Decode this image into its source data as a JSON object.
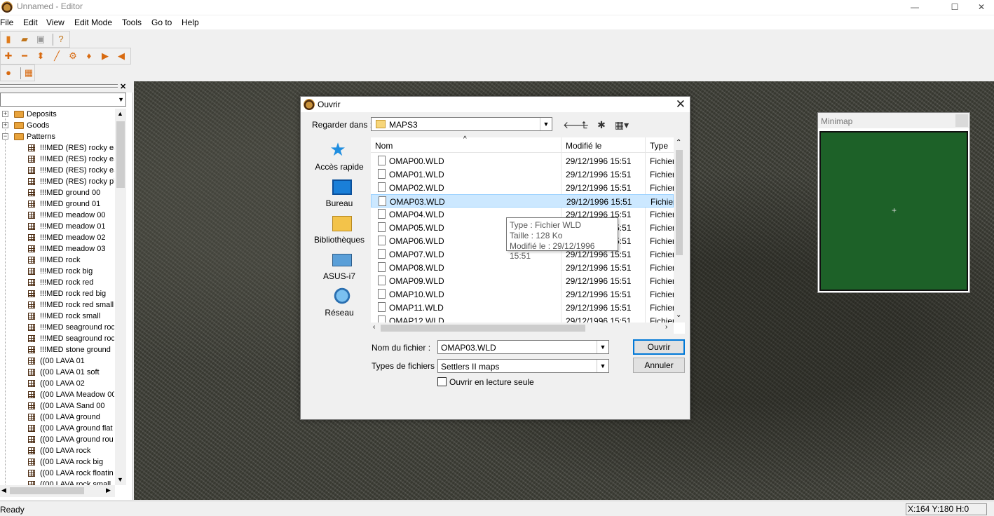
{
  "window": {
    "title": "Unnamed - Editor",
    "min": "—",
    "max": "☐",
    "close": "✕"
  },
  "menu": [
    "File",
    "Edit",
    "View",
    "Edit Mode",
    "Tools",
    "Go to",
    "Help"
  ],
  "toolbar1": [
    {
      "name": "new-icon",
      "glyph": "▮",
      "color": "#e07b1a"
    },
    {
      "name": "open-icon",
      "glyph": "▰",
      "color": "#c0741a"
    },
    {
      "name": "save-icon",
      "glyph": "▣",
      "color": "#9a9a9a"
    },
    {
      "name": "help-icon",
      "glyph": "?",
      "color": "#c0741a"
    }
  ],
  "toolbar2": [
    {
      "name": "raise-icon",
      "glyph": "✚",
      "color": "#d86a10"
    },
    {
      "name": "lower-icon",
      "glyph": "━",
      "color": "#d86a10"
    },
    {
      "name": "plane-icon",
      "glyph": "⬍",
      "color": "#d86a10"
    },
    {
      "name": "brush-icon",
      "glyph": "╱",
      "color": "#d86a10"
    },
    {
      "name": "objects-icon",
      "glyph": "⚙",
      "color": "#d86a10"
    },
    {
      "name": "fill-icon",
      "glyph": "♦",
      "color": "#d86a10"
    },
    {
      "name": "play-icon",
      "glyph": "▶",
      "color": "#d86a10"
    },
    {
      "name": "sound-icon",
      "glyph": "◀",
      "color": "#d86a10"
    }
  ],
  "toolbar3": [
    {
      "name": "marker-icon",
      "glyph": "●",
      "color": "#d86a10"
    },
    {
      "name": "copy-icon",
      "glyph": "▦",
      "color": "#d86a10"
    }
  ],
  "left_panel": {
    "close": "✕",
    "tree": [
      {
        "kind": "folder",
        "label": "Deposits",
        "expander": "+"
      },
      {
        "kind": "folder",
        "label": "Goods",
        "expander": "+"
      },
      {
        "kind": "folder",
        "label": "Patterns",
        "expander": "−"
      },
      {
        "kind": "item",
        "label": "!!!MED (RES) rocky ea"
      },
      {
        "kind": "item",
        "label": "!!!MED (RES) rocky ea"
      },
      {
        "kind": "item",
        "label": "!!!MED (RES) rocky ea"
      },
      {
        "kind": "item",
        "label": "!!!MED (RES) rocky pla"
      },
      {
        "kind": "item",
        "label": "!!!MED ground 00"
      },
      {
        "kind": "item",
        "label": "!!!MED ground 01"
      },
      {
        "kind": "item",
        "label": "!!!MED meadow 00"
      },
      {
        "kind": "item",
        "label": "!!!MED meadow 01"
      },
      {
        "kind": "item",
        "label": "!!!MED meadow 02"
      },
      {
        "kind": "item",
        "label": "!!!MED meadow 03"
      },
      {
        "kind": "item",
        "label": "!!!MED rock"
      },
      {
        "kind": "item",
        "label": "!!!MED rock big"
      },
      {
        "kind": "item",
        "label": "!!!MED rock red"
      },
      {
        "kind": "item",
        "label": "!!!MED rock red big"
      },
      {
        "kind": "item",
        "label": "!!!MED rock red small"
      },
      {
        "kind": "item",
        "label": "!!!MED rock small"
      },
      {
        "kind": "item",
        "label": "!!!MED seaground roc"
      },
      {
        "kind": "item",
        "label": "!!!MED seaground roc"
      },
      {
        "kind": "item",
        "label": "!!!MED stone ground"
      },
      {
        "kind": "item",
        "label": "((00 LAVA 01"
      },
      {
        "kind": "item",
        "label": "((00 LAVA 01 soft"
      },
      {
        "kind": "item",
        "label": "((00 LAVA 02"
      },
      {
        "kind": "item",
        "label": "((00 LAVA Meadow 00"
      },
      {
        "kind": "item",
        "label": "((00 LAVA Sand 00"
      },
      {
        "kind": "item",
        "label": "((00 LAVA ground"
      },
      {
        "kind": "item",
        "label": "((00 LAVA ground flat"
      },
      {
        "kind": "item",
        "label": "((00 LAVA ground rou"
      },
      {
        "kind": "item",
        "label": "((00 LAVA rock"
      },
      {
        "kind": "item",
        "label": "((00 LAVA rock big"
      },
      {
        "kind": "item",
        "label": "((00 LAVA rock floatin"
      },
      {
        "kind": "item",
        "label": "((00 LAVA rock small"
      }
    ]
  },
  "minimap": {
    "title": "Minimap",
    "cross": "+"
  },
  "dialog": {
    "title": "Ouvrir",
    "close": "✕",
    "look_in_label": "Regarder dans :",
    "look_in_value": "MAPS3",
    "places": [
      {
        "name": "quick-access",
        "label": "Accès rapide"
      },
      {
        "name": "desktop",
        "label": "Bureau"
      },
      {
        "name": "libraries",
        "label": "Bibliothèques"
      },
      {
        "name": "this-pc",
        "label": "ASUS-i7"
      },
      {
        "name": "network",
        "label": "Réseau"
      }
    ],
    "columns": {
      "name": "Nom",
      "modified": "Modifié le",
      "type": "Type",
      "sort_glyph": "^"
    },
    "files": [
      {
        "name": "OMAP00.WLD",
        "date": "29/12/1996 15:51",
        "type": "Fichier"
      },
      {
        "name": "OMAP01.WLD",
        "date": "29/12/1996 15:51",
        "type": "Fichier"
      },
      {
        "name": "OMAP02.WLD",
        "date": "29/12/1996 15:51",
        "type": "Fichier"
      },
      {
        "name": "OMAP03.WLD",
        "date": "29/12/1996 15:51",
        "type": "Fichier",
        "selected": true
      },
      {
        "name": "OMAP04.WLD",
        "date": "29/12/1996 15:51",
        "type": "Fichier"
      },
      {
        "name": "OMAP05.WLD",
        "date": "29/12/1996 15:51",
        "type": "Fichier"
      },
      {
        "name": "OMAP06.WLD",
        "date": "29/12/1996 15:51",
        "type": "Fichier"
      },
      {
        "name": "OMAP07.WLD",
        "date": "29/12/1996 15:51",
        "type": "Fichier"
      },
      {
        "name": "OMAP08.WLD",
        "date": "29/12/1996 15:51",
        "type": "Fichier"
      },
      {
        "name": "OMAP09.WLD",
        "date": "29/12/1996 15:51",
        "type": "Fichier"
      },
      {
        "name": "OMAP10.WLD",
        "date": "29/12/1996 15:51",
        "type": "Fichier"
      },
      {
        "name": "OMAP11.WLD",
        "date": "29/12/1996 15:51",
        "type": "Fichier"
      },
      {
        "name": "OMAP12.WLD",
        "date": "29/12/1996 15:51",
        "type": "Fichier"
      }
    ],
    "tooltip": {
      "type": "Type : Fichier WLD",
      "size": "Taille : 128 Ko",
      "modified": "Modifié le : 29/12/1996 15:51"
    },
    "filename_label": "Nom du fichier :",
    "filename_value": "OMAP03.WLD",
    "filetype_label": "Types de fichiers :",
    "filetype_value": "Settlers II maps",
    "readonly_label": "Ouvrir en lecture seule",
    "open_button": "Ouvrir",
    "cancel_button": "Annuler"
  },
  "status": {
    "text": "Ready",
    "coords": "X:164 Y:180 H:0"
  }
}
